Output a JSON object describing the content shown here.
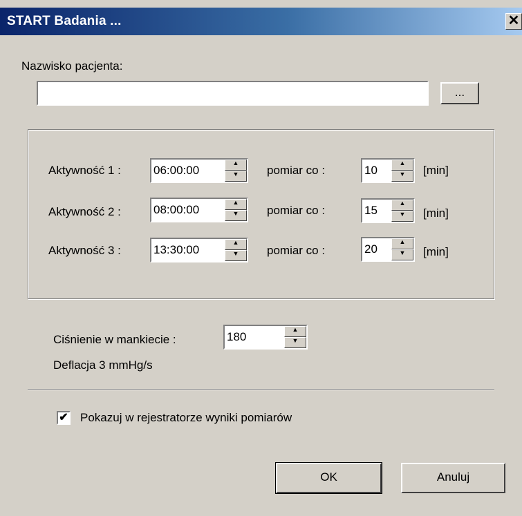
{
  "window": {
    "title": "START Badania ...",
    "close_label": "✕"
  },
  "patient": {
    "label": "Nazwisko pacjenta:",
    "value": "",
    "browse_label": "..."
  },
  "activities": [
    {
      "label": "Aktywność 1 :",
      "time": "06:00:00",
      "interval_label": "pomiar co :",
      "interval": "10",
      "unit": "[min]"
    },
    {
      "label": "Aktywność 2 :",
      "time": "08:00:00",
      "interval_label": "pomiar co :",
      "interval": "15",
      "unit": "[min]"
    },
    {
      "label": "Aktywność 3 :",
      "time": "13:30:00",
      "interval_label": "pomiar co :",
      "interval": "20",
      "unit": "[min]"
    }
  ],
  "cuff": {
    "label": "Ciśnienie w mankiecie :",
    "value": "180",
    "deflation": "Deflacja  3 mmHg/s"
  },
  "show_results": {
    "label": "Pokazuj w rejestratorze wyniki pomiarów",
    "checked": true,
    "check_mark": "✔"
  },
  "buttons": {
    "ok": "OK",
    "cancel": "Anuluj"
  },
  "icons": {
    "spin_up": "up-arrow",
    "spin_down": "down-arrow"
  }
}
